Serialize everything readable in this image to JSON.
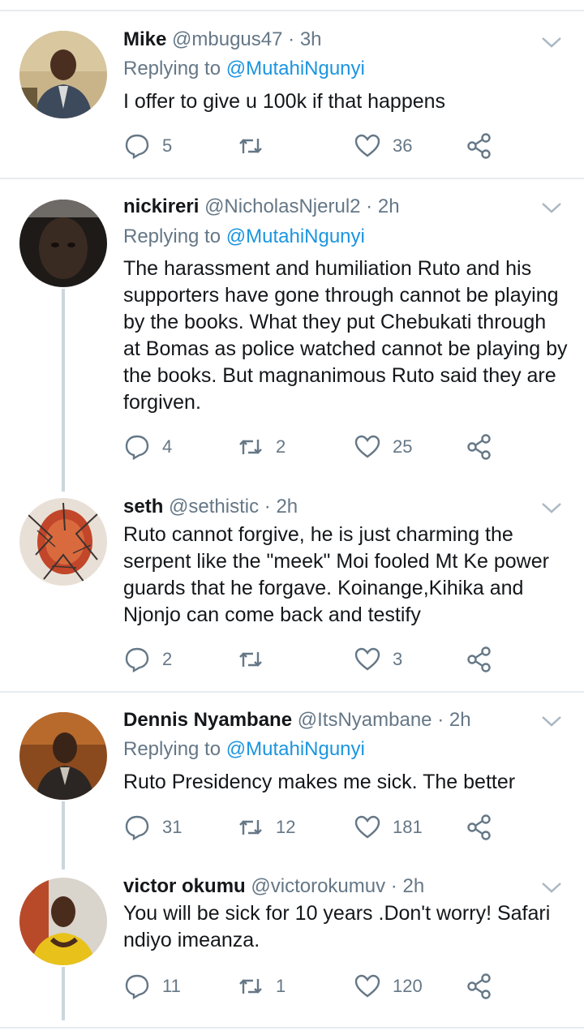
{
  "tweets": [
    {
      "name": "Mike",
      "handle": "@mbugus47",
      "time": "3h",
      "replying_label": "Replying to",
      "replying_to": "@MutahiNgunyi",
      "text": "I offer to give u 100k if that happens",
      "replies": "5",
      "retweets": "",
      "likes": "36"
    },
    {
      "name": "nickireri",
      "handle": "@NicholasNjerul2",
      "time": "2h",
      "replying_label": "Replying to",
      "replying_to": "@MutahiNgunyi",
      "text": "The harassment and humiliation Ruto and his supporters have gone through cannot be playing by the books. What they put Chebukati through at Bomas as police watched cannot be playing by the books. But magnanimous Ruto said they are forgiven.",
      "replies": "4",
      "retweets": "2",
      "likes": "25"
    },
    {
      "name": "seth",
      "handle": "@sethistic",
      "time": "2h",
      "text": "Ruto cannot forgive, he is just charming the serpent like the \"meek\" Moi fooled Mt Ke power guards that he forgave. Koinange,Kihika and Njonjo can come back and testify",
      "replies": "2",
      "retweets": "",
      "likes": "3"
    },
    {
      "name": "Dennis Nyambane",
      "handle": "@ItsNyambane",
      "time": "2h",
      "replying_label": "Replying to",
      "replying_to": "@MutahiNgunyi",
      "text": "Ruto Presidency makes me sick. The better",
      "replies": "31",
      "retweets": "12",
      "likes": "181"
    },
    {
      "name": "victor okumu",
      "handle": "@victorokumuv",
      "time": "2h",
      "text": "You will be sick for 10 years .Don't worry! Safari ndiyo imeanza.",
      "replies": "11",
      "retweets": "1",
      "likes": "120"
    }
  ],
  "separator": "·",
  "icons": {
    "reply": "reply-icon",
    "retweet": "retweet-icon",
    "like": "heart-icon",
    "share": "share-icon",
    "caret": "chevron-down-icon"
  },
  "colors": {
    "text": "#14171a",
    "muted": "#657786",
    "link": "#1b95e0",
    "divider": "#e6ecf0",
    "thread": "#ccd6dd"
  }
}
